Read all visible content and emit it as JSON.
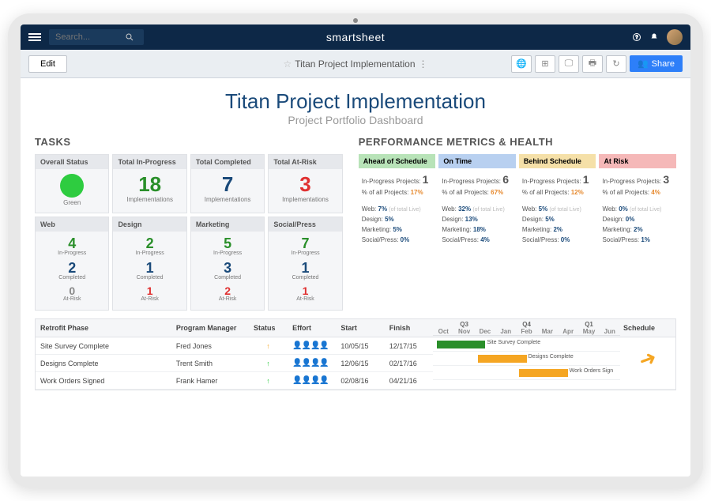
{
  "topbar": {
    "search_placeholder": "Search...",
    "brand": "smartsheet"
  },
  "toolbar": {
    "edit_label": "Edit",
    "sheet_name": "Titan Project Implementation",
    "share_label": "Share"
  },
  "title": {
    "main": "Titan Project Implementation",
    "sub": "Project Portfolio Dashboard"
  },
  "tasks": {
    "heading": "TASKS",
    "row1": [
      {
        "hdr": "Overall Status",
        "circle_color": "#2ecc40",
        "value": "",
        "sub": "Green",
        "color": "#2ecc40"
      },
      {
        "hdr": "Total In-Progress",
        "value": "18",
        "sub": "Implementations",
        "color": "#2a8f2a"
      },
      {
        "hdr": "Total Completed",
        "value": "7",
        "sub": "Implementations",
        "color": "#1a4a7a"
      },
      {
        "hdr": "Total At-Risk",
        "value": "3",
        "sub": "Implementations",
        "color": "#e03131"
      }
    ],
    "row2_headers": [
      "Web",
      "Design",
      "Marketing",
      "Social/Press"
    ],
    "row2": [
      {
        "inprog": "4",
        "completed": "2",
        "atrisk": "0",
        "ip_color": "#2a8f2a",
        "atrisk_color": "#888"
      },
      {
        "inprog": "2",
        "completed": "1",
        "atrisk": "1",
        "ip_color": "#2a8f2a",
        "atrisk_color": "#e03131"
      },
      {
        "inprog": "5",
        "completed": "3",
        "atrisk": "2",
        "ip_color": "#2a8f2a",
        "atrisk_color": "#e03131"
      },
      {
        "inprog": "7",
        "completed": "1",
        "atrisk": "1",
        "ip_color": "#2a8f2a",
        "atrisk_color": "#e03131"
      }
    ],
    "labels": {
      "inprog": "In-Progress",
      "completed": "Completed",
      "atrisk": "At-Risk"
    }
  },
  "metrics": {
    "heading": "PERFORMANCE METRICS & HEALTH",
    "cols": [
      {
        "hdr": "Ahead of Schedule",
        "bg": "#b8e3b8",
        "inprog": "1",
        "pct_all": "17%",
        "pct_color": "#e6892e",
        "breakdown": [
          [
            "Web",
            "7%"
          ],
          [
            "Design",
            "5%"
          ],
          [
            "Marketing",
            "5%"
          ],
          [
            "Social/Press",
            "0%"
          ]
        ]
      },
      {
        "hdr": "On Time",
        "bg": "#b8d0f0",
        "inprog": "6",
        "pct_all": "67%",
        "pct_color": "#e6892e",
        "breakdown": [
          [
            "Web",
            "32%"
          ],
          [
            "Design",
            "13%"
          ],
          [
            "Marketing",
            "18%"
          ],
          [
            "Social/Press",
            "4%"
          ]
        ]
      },
      {
        "hdr": "Behind Schedule",
        "bg": "#f5e0a8",
        "inprog": "1",
        "pct_all": "12%",
        "pct_color": "#e6892e",
        "breakdown": [
          [
            "Web",
            "5%"
          ],
          [
            "Design",
            "5%"
          ],
          [
            "Marketing",
            "2%"
          ],
          [
            "Social/Press",
            "0%"
          ]
        ]
      },
      {
        "hdr": "At Risk",
        "bg": "#f5b8b8",
        "inprog": "3",
        "pct_all": "4%",
        "pct_color": "#e6892e",
        "breakdown": [
          [
            "Web",
            "0%"
          ],
          [
            "Design",
            "0%"
          ],
          [
            "Marketing",
            "2%"
          ],
          [
            "Social/Press",
            "1%"
          ]
        ]
      }
    ],
    "labels": {
      "inprog": "In-Progress Projects:",
      "pct_all": "% of all Projects:",
      "of_total": "(of total Live)"
    }
  },
  "table": {
    "headers": [
      "Retrofit Phase",
      "Program Manager",
      "Status",
      "Effort",
      "Start",
      "Finish"
    ],
    "rows": [
      {
        "phase": "Site Survey Complete",
        "pm": "Fred Jones",
        "status": "↑",
        "status_color": "#f5a623",
        "effort": "👤👤👤👤",
        "start": "10/05/15",
        "finish": "12/17/15"
      },
      {
        "phase": "Designs Complete",
        "pm": "Trent Smith",
        "status": "↑",
        "status_color": "#2ecc40",
        "effort": "👤👤👤👤",
        "start": "12/06/15",
        "finish": "02/17/16"
      },
      {
        "phase": "Work Orders Signed",
        "pm": "Frank Hamer",
        "status": "↑",
        "status_color": "#2ecc40",
        "effort": "👤👤👤👤",
        "start": "02/08/16",
        "finish": "04/21/16"
      }
    ],
    "gantt": {
      "quarters": [
        "Q3",
        "Q4",
        "Q1"
      ],
      "months": [
        "Oct",
        "Nov",
        "Dec",
        "Jan",
        "Feb",
        "Mar",
        "Apr",
        "May",
        "Jun"
      ],
      "bars": [
        {
          "left": "2%",
          "width": "26%",
          "color": "#2a8f2a",
          "label": "Site Survey Complete"
        },
        {
          "left": "24%",
          "width": "26%",
          "color": "#f5a623",
          "label": "Designs Complete"
        },
        {
          "left": "46%",
          "width": "26%",
          "color": "#f5a623",
          "label": "Work Orders Sign"
        }
      ],
      "schedule_label": "Schedule"
    }
  }
}
